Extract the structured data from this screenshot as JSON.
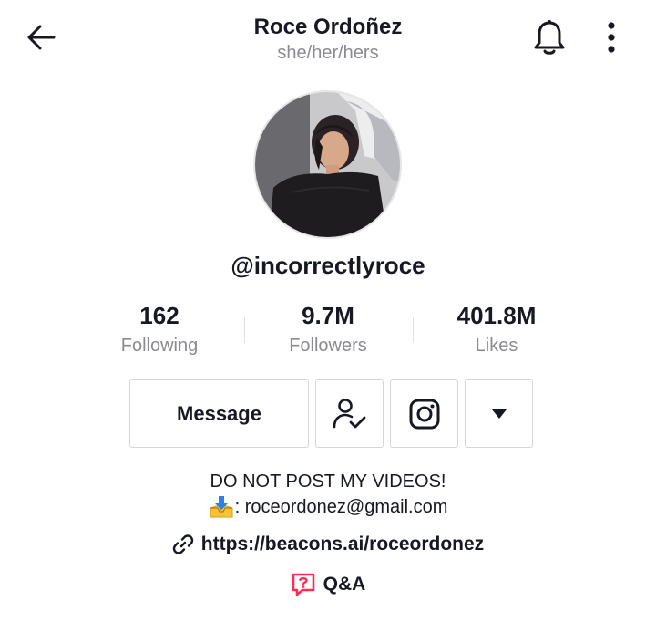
{
  "header": {
    "name": "Roce Ordoñez",
    "pronouns": "she/her/hers",
    "icons": {
      "back": "arrow-left-icon",
      "notifications": "bell-icon",
      "more": "vertical-dots-icon"
    }
  },
  "profile": {
    "username": "@incorrectlyroce",
    "avatar_icon": "profile-photo"
  },
  "stats": [
    {
      "value": "162",
      "label": "Following"
    },
    {
      "value": "9.7M",
      "label": "Followers"
    },
    {
      "value": "401.8M",
      "label": "Likes"
    }
  ],
  "actions": {
    "message_label": "Message",
    "icons": {
      "following": "person-check-icon",
      "instagram": "instagram-icon",
      "more": "caret-down-icon"
    }
  },
  "bio": {
    "line1": "DO NOT POST MY VIDEOS!",
    "email_emoji": "inbox-tray-emoji",
    "email_text": ": roceordonez@gmail.com"
  },
  "link": {
    "text": "https://beacons.ai/roceordonez",
    "icon": "link-chain-icon"
  },
  "qa": {
    "text": "Q&A",
    "icon": "question-bubble-icon",
    "icon_color": "#fe2c55"
  },
  "colors": {
    "text_primary": "#161823",
    "text_secondary": "#8a8b91",
    "border": "#d6d6d8",
    "accent": "#fe2c55"
  }
}
